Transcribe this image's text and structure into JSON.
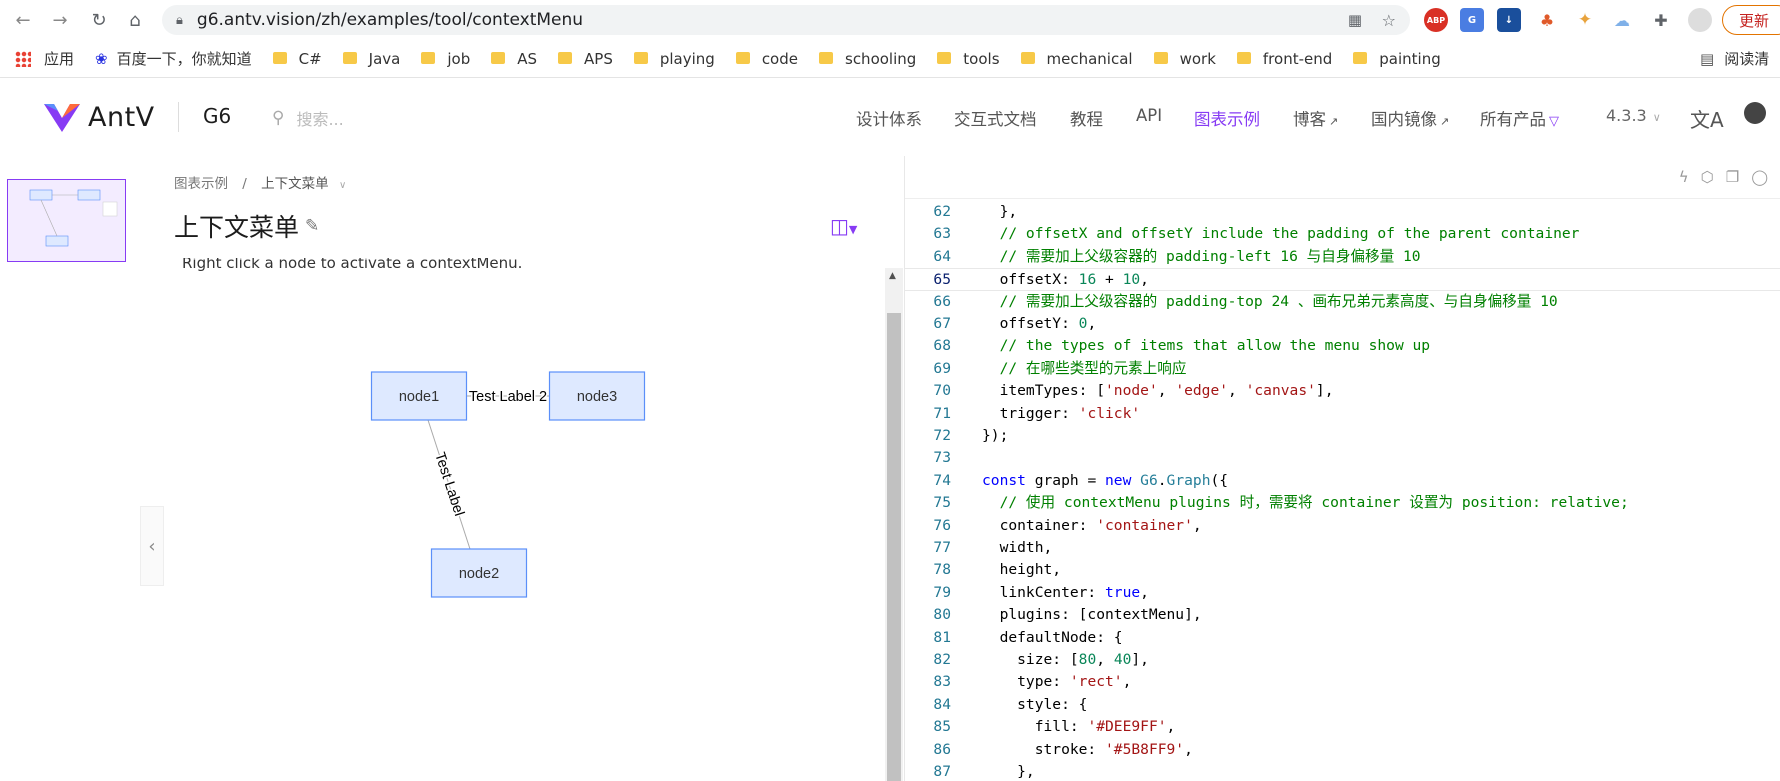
{
  "browser": {
    "url": "g6.antv.vision/zh/examples/tool/contextMenu",
    "update_button": "更新",
    "bookmarks_reader": "阅读清",
    "bookmarks": [
      {
        "label": "应用",
        "type": "apps"
      },
      {
        "label": "百度一下，你就知道",
        "type": "baidu"
      },
      {
        "label": "C#",
        "type": "folder"
      },
      {
        "label": "Java",
        "type": "folder"
      },
      {
        "label": "job",
        "type": "folder"
      },
      {
        "label": "AS",
        "type": "folder"
      },
      {
        "label": "APS",
        "type": "folder"
      },
      {
        "label": "playing",
        "type": "folder"
      },
      {
        "label": "code",
        "type": "folder"
      },
      {
        "label": "schooling",
        "type": "folder"
      },
      {
        "label": "tools",
        "type": "folder"
      },
      {
        "label": "mechanical",
        "type": "folder"
      },
      {
        "label": "work",
        "type": "folder"
      },
      {
        "label": "front-end",
        "type": "folder"
      },
      {
        "label": "painting",
        "type": "folder"
      }
    ],
    "extensions": [
      "ABP",
      "G",
      "↓",
      "♣",
      "✦",
      "☁",
      "puzzle"
    ]
  },
  "site": {
    "brand": "AntV",
    "product": "G6",
    "search_placeholder": "搜索...",
    "nav": [
      {
        "label": "设计体系",
        "external": false,
        "active": false
      },
      {
        "label": "交互式文档",
        "external": false,
        "active": false
      },
      {
        "label": "教程",
        "external": false,
        "active": false
      },
      {
        "label": "API",
        "external": false,
        "active": false
      },
      {
        "label": "图表示例",
        "external": false,
        "active": true
      },
      {
        "label": "博客",
        "external": true,
        "active": false
      },
      {
        "label": "国内镜像",
        "external": true,
        "active": false
      },
      {
        "label": "所有产品",
        "external": false,
        "active": false
      }
    ],
    "version": "4.3.3",
    "accent_color": "#873bf4"
  },
  "example": {
    "breadcrumb_root": "图表示例",
    "breadcrumb_current": "上下文菜单",
    "title": "上下文菜单",
    "description": "Right click a node to activate a contextMenu."
  },
  "graph": {
    "node_fill": "#DEE9FF",
    "node_stroke": "#5B8FF9",
    "nodes": [
      {
        "id": "node1",
        "label": "node1"
      },
      {
        "id": "node2",
        "label": "node2"
      },
      {
        "id": "node3",
        "label": "node3"
      }
    ],
    "edges": [
      {
        "source": "node1",
        "target": "node2",
        "label": "Test Label"
      },
      {
        "source": "node1",
        "target": "node3",
        "label": "Test Label 2"
      }
    ]
  },
  "code": {
    "first_line": 62,
    "current_line": 65,
    "lines": [
      [
        [
          "p",
          "  },"
        ]
      ],
      [
        [
          "c",
          "  // offsetX and offsetY include the padding of the parent container"
        ]
      ],
      [
        [
          "c",
          "  // 需要加上父级容器的 padding-left 16 与自身偏移量 10"
        ]
      ],
      [
        [
          "p",
          "  offsetX: "
        ],
        [
          "num",
          "16"
        ],
        [
          "p",
          " + "
        ],
        [
          "num",
          "10"
        ],
        [
          "p",
          ","
        ]
      ],
      [
        [
          "c",
          "  // 需要加上父级容器的 padding-top 24 、画布兄弟元素高度、与自身偏移量 10"
        ]
      ],
      [
        [
          "p",
          "  offsetY: "
        ],
        [
          "num",
          "0"
        ],
        [
          "p",
          ","
        ]
      ],
      [
        [
          "c",
          "  // the types of items that allow the menu show up"
        ]
      ],
      [
        [
          "c",
          "  // 在哪些类型的元素上响应"
        ]
      ],
      [
        [
          "p",
          "  itemTypes: ["
        ],
        [
          "s",
          "'node'"
        ],
        [
          "p",
          ", "
        ],
        [
          "s",
          "'edge'"
        ],
        [
          "p",
          ", "
        ],
        [
          "s",
          "'canvas'"
        ],
        [
          "p",
          "],"
        ]
      ],
      [
        [
          "p",
          "  trigger: "
        ],
        [
          "s",
          "'click'"
        ]
      ],
      [
        [
          "p",
          "});"
        ]
      ],
      [
        [
          "p",
          ""
        ]
      ],
      [
        [
          "k",
          "const"
        ],
        [
          "p",
          " graph = "
        ],
        [
          "k",
          "new"
        ],
        [
          "p",
          " "
        ],
        [
          "f",
          "G6"
        ],
        [
          "p",
          "."
        ],
        [
          "f",
          "Graph"
        ],
        [
          "p",
          "({"
        ]
      ],
      [
        [
          "c",
          "  // 使用 contextMenu plugins 时，需要将 container 设置为 position: relative;"
        ]
      ],
      [
        [
          "p",
          "  container: "
        ],
        [
          "s",
          "'container'"
        ],
        [
          "p",
          ","
        ]
      ],
      [
        [
          "p",
          "  width,"
        ]
      ],
      [
        [
          "p",
          "  height,"
        ]
      ],
      [
        [
          "p",
          "  linkCenter: "
        ],
        [
          "k",
          "true"
        ],
        [
          "p",
          ","
        ]
      ],
      [
        [
          "p",
          "  plugins: [contextMenu],"
        ]
      ],
      [
        [
          "p",
          "  defaultNode: {"
        ]
      ],
      [
        [
          "p",
          "    size: ["
        ],
        [
          "num",
          "80"
        ],
        [
          "p",
          ", "
        ],
        [
          "num",
          "40"
        ],
        [
          "p",
          "],"
        ]
      ],
      [
        [
          "p",
          "    type: "
        ],
        [
          "s",
          "'rect'"
        ],
        [
          "p",
          ","
        ]
      ],
      [
        [
          "p",
          "    style: {"
        ]
      ],
      [
        [
          "p",
          "      fill: "
        ],
        [
          "s",
          "'#DEE9FF'"
        ],
        [
          "p",
          ","
        ]
      ],
      [
        [
          "p",
          "      stroke: "
        ],
        [
          "s",
          "'#5B8FF9'"
        ],
        [
          "p",
          ","
        ]
      ],
      [
        [
          "p",
          "    },"
        ]
      ]
    ]
  }
}
